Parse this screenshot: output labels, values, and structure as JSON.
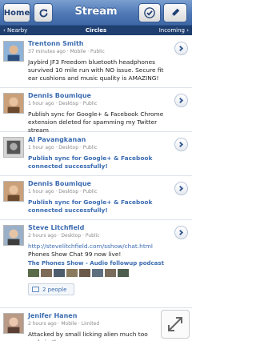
{
  "header": {
    "home_label": "Home",
    "title": "Stream",
    "refresh_icon": "refresh-icon",
    "check_icon": "check-icon",
    "edit_icon": "pencil-icon"
  },
  "subnav": {
    "left": "‹ Nearby",
    "center": "Circles",
    "right": "Incoming ›"
  },
  "posts": [
    {
      "name": "Trentonn Smith",
      "meta": "37 minutes ago · Mobile · Public",
      "body": "Jaybird JF3 Freedom bluetooth headphones survived 10 mile run with NO issue. Secure fit ear cushions and music quality is AMAZING!"
    },
    {
      "name": "Dennis Boumique",
      "meta": "1 hour ago · Desktop · Public",
      "body": "Publish sync for Google+ & Facebook Chrome extension deleted for spamming my Twitter stream"
    },
    {
      "name": "Al Pavangkanan",
      "meta": "1 hour ago · Desktop · Public",
      "body": "Publish sync for Google+ & Facebook connected successfully!"
    },
    {
      "name": "Dennis Boumique",
      "meta": "1 hour ago · Desktop · Public",
      "body": "Publish sync for Google+ & Facebook connected successfully!"
    },
    {
      "name": "Steve Litchfield",
      "meta": "2 hours ago · Desktop · Public",
      "url": "http://stevelitchfield.com/sshow/chat.html",
      "body_after": " Phones Show Chat 99 now live!",
      "album": "The Phones Show - Audio followup podcast",
      "people": "2 people"
    },
    {
      "name": "Jenifer Hanen",
      "meta": "2 hours ago · Mobile · Limited",
      "body": "Attacked by small licking alien much too early in the"
    }
  ]
}
